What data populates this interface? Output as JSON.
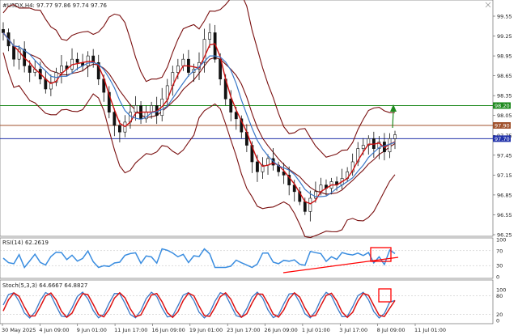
{
  "window": {
    "symbol_header": "#USDX,H4:  97.77 97.86 97.74 97.76"
  },
  "price_panel": {
    "price_ticks": [
      "99.55",
      "99.25",
      "98.95",
      "98.65",
      "98.35",
      "98.05",
      "97.75",
      "97.45",
      "97.15",
      "96.85",
      "96.55",
      "96.25"
    ],
    "levels": [
      {
        "label": "98.20",
        "color": "#1f8a1f"
      },
      {
        "label": "97.90",
        "color": "#a0522d"
      },
      {
        "label": "97.70",
        "color": "#2233aa"
      }
    ]
  },
  "rsi_panel": {
    "header": "RSI(14) 62.2619",
    "ticks": [
      "100",
      "70",
      "30",
      "0"
    ]
  },
  "stoch_panel": {
    "header": "Stoch(5,3,3) 64.6667 64.8827",
    "ticks": [
      "100",
      "80",
      "20",
      "0"
    ]
  },
  "time_axis": {
    "labels": [
      "30 May 2025",
      "4 Jun 09:00",
      "9 Jun 01:00",
      "11 Jun 17:00",
      "16 Jun 09:00",
      "19 Jun 01:00",
      "23 Jun 17:00",
      "26 Jun 09:00",
      "1 Jul 01:00",
      "3 Jul 17:00",
      "8 Jul 09:00",
      "11 Jul 01:00"
    ]
  },
  "colors": {
    "candle": "#111111",
    "ma_fast": "#cc1111",
    "ma_slow": "#3a78c8",
    "bollinger": "#7a1010",
    "rsi": "#3a8de0",
    "stoch_main": "#3a78c8",
    "stoch_signal": "#dd1111",
    "highlight": "#ff0000",
    "arrow": "#1f8a1f"
  },
  "chart_data": {
    "type": "candlestick",
    "title": "#USDX,H4",
    "ohlc_last": {
      "open": 97.77,
      "high": 97.86,
      "low": 97.74,
      "close": 97.76
    },
    "ylim": [
      96.25,
      99.7
    ],
    "close_path": [
      99.3,
      99.1,
      98.9,
      99.05,
      98.8,
      98.7,
      98.75,
      98.6,
      98.45,
      98.55,
      98.7,
      98.8,
      98.75,
      98.9,
      98.85,
      98.8,
      98.95,
      98.85,
      98.6,
      98.4,
      98.1,
      97.9,
      97.8,
      97.95,
      98.1,
      98.2,
      98.0,
      98.1,
      98.2,
      98.05,
      98.3,
      98.5,
      98.7,
      98.8,
      98.9,
      98.7,
      98.75,
      98.85,
      99.2,
      99.3,
      98.9,
      98.6,
      98.3,
      98.1,
      98.0,
      97.8,
      97.6,
      97.35,
      97.2,
      97.3,
      97.4,
      97.3,
      97.2,
      97.15,
      97.0,
      96.9,
      96.75,
      96.6,
      96.8,
      96.9,
      97.0,
      96.95,
      97.05,
      97.0,
      97.1,
      97.2,
      97.35,
      97.55,
      97.6,
      97.7,
      97.55,
      97.65,
      97.5,
      97.7,
      97.76
    ],
    "rsi_last": 62.2619,
    "stoch_last": [
      64.6667,
      64.8827
    ]
  }
}
